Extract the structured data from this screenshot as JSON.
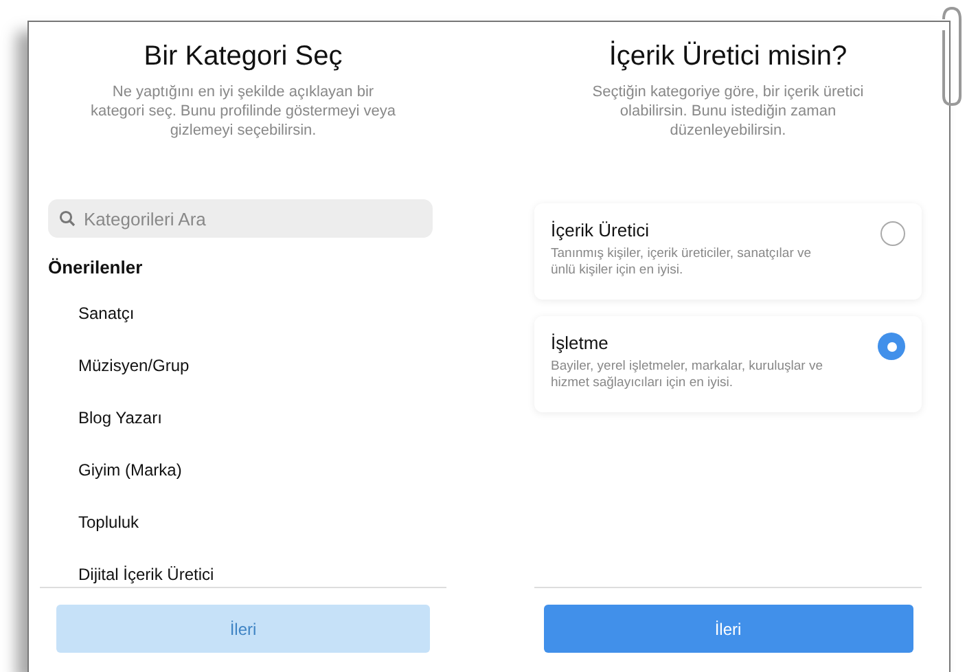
{
  "category_screen": {
    "title": "Bir Kategori Seç",
    "subtitle": "Ne yaptığını en iyi şekilde açıklayan bir kategori seç. Bunu profilinde göstermeyi veya gizlemeyi seçebilirsin.",
    "search": {
      "placeholder": "Kategorileri Ara"
    },
    "section_title": "Önerilenler",
    "items": [
      {
        "label": "Sanatçı"
      },
      {
        "label": "Müzisyen/Grup"
      },
      {
        "label": "Blog Yazarı"
      },
      {
        "label": "Giyim (Marka)"
      },
      {
        "label": "Topluluk"
      },
      {
        "label": "Dijital İçerik Üretici"
      }
    ],
    "button": {
      "label": "İleri",
      "disabled": true
    }
  },
  "creator_screen": {
    "title": "İçerik Üretici misin?",
    "subtitle": "Seçtiğin kategoriye göre, bir içerik üretici olabilirsin. Bunu istediğin zaman düzenleyebilirsin.",
    "options": [
      {
        "title": "İçerik Üretici",
        "description": "Tanınmış kişiler, içerik üreticiler, sanatçılar ve ünlü kişiler için en iyisi.",
        "selected": false
      },
      {
        "title": "İşletme",
        "description": "Bayiler, yerel işletmeler, markalar, kuruluşlar ve hizmet sağlayıcıları için en iyisi.",
        "selected": true
      }
    ],
    "button": {
      "label": "İleri",
      "disabled": false
    }
  }
}
